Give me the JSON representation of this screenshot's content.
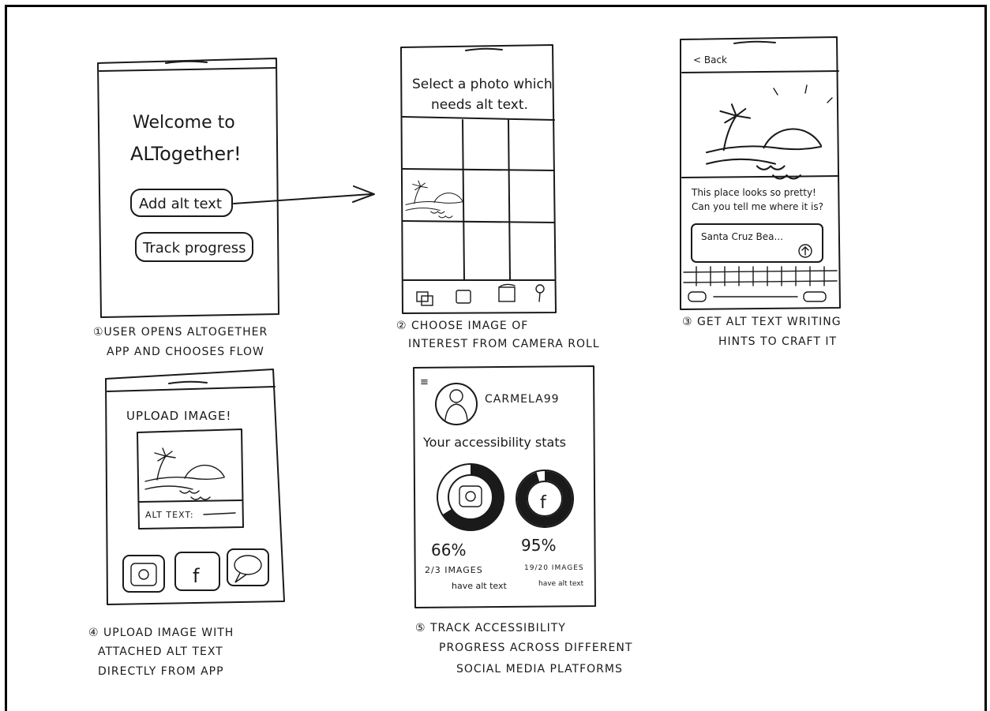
{
  "screens": {
    "s1": {
      "welcome_line1": "Welcome to",
      "welcome_line2": "ALTogether!",
      "btn_add": "Add alt text",
      "btn_track": "Track progress",
      "caption_line1": "①USER OPENS ALTOGETHER",
      "caption_line2": "APP AND CHOOSES FLOW"
    },
    "s2": {
      "prompt_line1": "Select a photo which",
      "prompt_line2": "needs alt text.",
      "caption_line1": "② CHOOSE IMAGE OF",
      "caption_line2": "INTEREST FROM CAMERA ROLL"
    },
    "s3": {
      "back": "< Back",
      "hint_line1": "This place looks so pretty!",
      "hint_line2": "Can you tell me where it is?",
      "input_value": "Santa Cruz Bea...",
      "caption_line1": "③ GET ALT TEXT WRITING",
      "caption_line2": "HINTS TO CRAFT IT"
    },
    "s4": {
      "title": "UPLOAD IMAGE!",
      "alt_label": "ALT TEXT:",
      "caption_line1": "④ UPLOAD IMAGE WITH",
      "caption_line2": "ATTACHED ALT TEXT",
      "caption_line3": "DIRECTLY FROM APP"
    },
    "s5": {
      "menu": "≡",
      "username": "CARMELA99",
      "stats_title": "Your accessibility stats",
      "ig_percent": "66%",
      "ig_count": "2/3 IMAGES",
      "ig_note": "have alt text",
      "ig_progress": 0.66,
      "fb_percent": "95%",
      "fb_count": "19/20 IMAGES",
      "fb_note": "have alt text",
      "fb_progress": 0.95,
      "caption_line1": "⑤ TRACK ACCESSIBILITY",
      "caption_line2": "PROGRESS ACROSS DIFFERENT",
      "caption_line3": "SOCIAL MEDIA PLATFORMS"
    }
  }
}
